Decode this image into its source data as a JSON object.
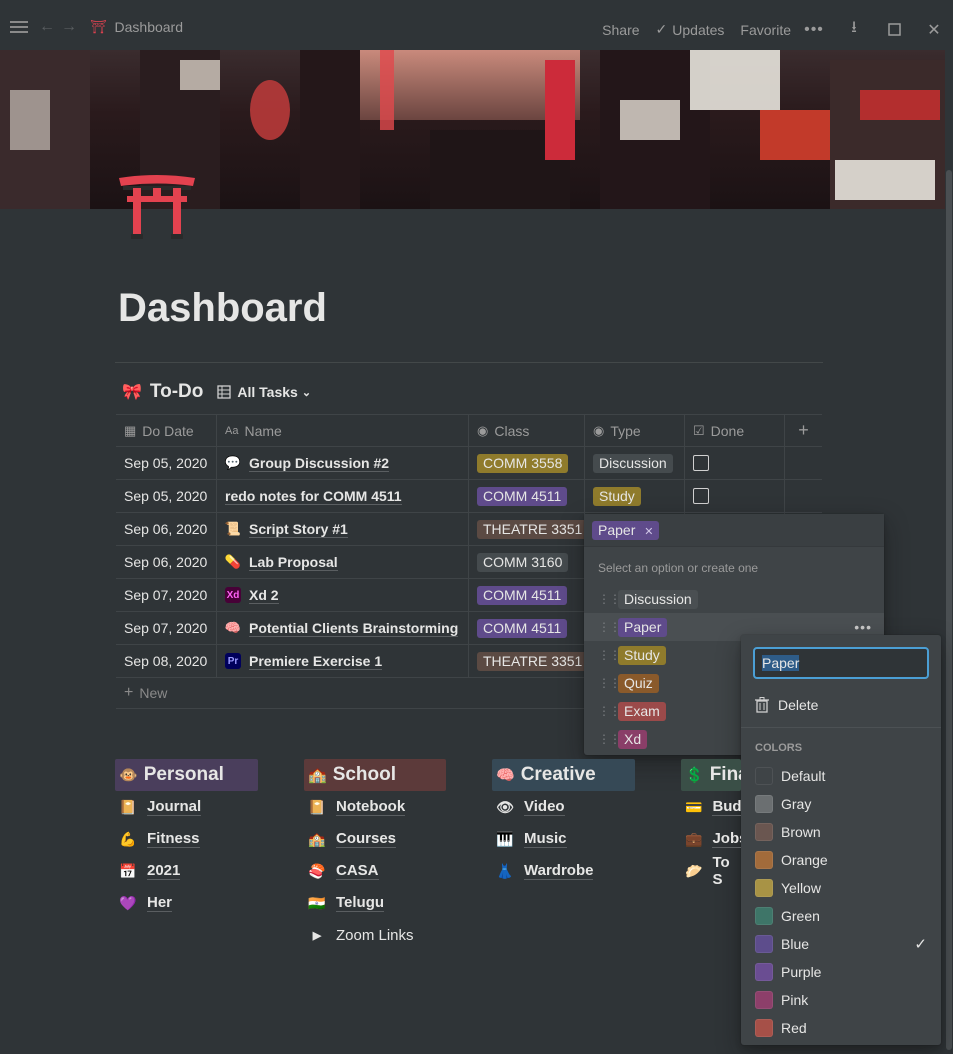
{
  "topbar": {
    "breadcrumb": "Dashboard",
    "share": "Share",
    "updates": "Updates",
    "favorite": "Favorite"
  },
  "page": {
    "title": "Dashboard"
  },
  "database": {
    "title": "To-Do",
    "view": "All Tasks",
    "columns": {
      "date": "Do Date",
      "name": "Name",
      "class": "Class",
      "type": "Type",
      "done": "Done"
    },
    "rows": [
      {
        "date": "Sep 05, 2020",
        "name": "Group Discussion #2",
        "icon": "speech-bubble-icon",
        "class": "COMM 3558",
        "class_color": "yellow",
        "type": "Discussion",
        "type_color": "gray"
      },
      {
        "date": "Sep 05, 2020",
        "name": "redo notes for COMM 4511",
        "icon": "",
        "class": "COMM 4511",
        "class_color": "purple",
        "type": "Study",
        "type_color": "yellow"
      },
      {
        "date": "Sep 06, 2020",
        "name": "Script Story #1",
        "icon": "scroll-icon",
        "class": "THEATRE 3351",
        "class_color": "brown",
        "type": "",
        "type_color": ""
      },
      {
        "date": "Sep 06, 2020",
        "name": "Lab Proposal",
        "icon": "pill-icon",
        "class": "COMM 3160",
        "class_color": "gray",
        "type": "",
        "type_color": ""
      },
      {
        "date": "Sep 07, 2020",
        "name": "Xd 2",
        "icon": "xd-icon",
        "class": "COMM 4511",
        "class_color": "purple",
        "type": "",
        "type_color": ""
      },
      {
        "date": "Sep 07, 2020",
        "name": "Potential Clients Brainstorming",
        "icon": "brain-icon",
        "class": "COMM 4511",
        "class_color": "purple",
        "type": "",
        "type_color": ""
      },
      {
        "date": "Sep 08, 2020",
        "name": "Premiere Exercise 1",
        "icon": "premiere-icon",
        "class": "THEATRE 3351",
        "class_color": "brown",
        "type": "",
        "type_color": ""
      }
    ],
    "new_label": "New"
  },
  "select_popup": {
    "selected_tag": "Paper",
    "hint": "Select an option or create one",
    "options": [
      {
        "label": "Discussion",
        "color": "#4a4f52"
      },
      {
        "label": "Paper",
        "color": "#5f4b8b"
      },
      {
        "label": "Study",
        "color": "#8f7b2c"
      },
      {
        "label": "Quiz",
        "color": "#8a5a2b"
      },
      {
        "label": "Exam",
        "color": "#9b4a4a"
      },
      {
        "label": "Xd",
        "color": "#8a3e68"
      }
    ]
  },
  "color_menu": {
    "input_value": "Paper",
    "delete_label": "Delete",
    "colors_heading": "COLORS",
    "colors": [
      {
        "label": "Default",
        "swatch": "#3f4447"
      },
      {
        "label": "Gray",
        "swatch": "#6b6f71"
      },
      {
        "label": "Brown",
        "swatch": "#6a5650"
      },
      {
        "label": "Orange",
        "swatch": "#a26b3b"
      },
      {
        "label": "Yellow",
        "swatch": "#a89345"
      },
      {
        "label": "Green",
        "swatch": "#3e7568"
      },
      {
        "label": "Blue",
        "swatch": "#5d4d8c"
      },
      {
        "label": "Purple",
        "swatch": "#6a4d92"
      },
      {
        "label": "Pink",
        "swatch": "#8d3f6a"
      },
      {
        "label": "Red",
        "swatch": "#a65048"
      }
    ],
    "selected": "Blue"
  },
  "nav_columns": [
    {
      "heading": "Personal",
      "heading_bg": "#4a3e5c",
      "icon": "monkey-icon",
      "items": [
        {
          "label": "Journal",
          "icon": "notebook-icon"
        },
        {
          "label": "Fitness",
          "icon": "flexed-arm-icon"
        },
        {
          "label": "2021",
          "icon": "calendar-icon"
        },
        {
          "label": "Her",
          "icon": "purple-heart-icon"
        }
      ]
    },
    {
      "heading": "School",
      "heading_bg": "#5c3a3a",
      "icon": "school-icon",
      "items": [
        {
          "label": "Notebook",
          "icon": "notebook-icon"
        },
        {
          "label": "Courses",
          "icon": "school-icon"
        },
        {
          "label": "CASA",
          "icon": "sushi-icon"
        },
        {
          "label": "Telugu",
          "icon": "india-flag-icon"
        },
        {
          "label": "Zoom Links",
          "icon": "toggle-triangle-icon"
        }
      ]
    },
    {
      "heading": "Creative",
      "heading_bg": "#364956",
      "icon": "brain-icon",
      "items": [
        {
          "label": "Video",
          "icon": "eye-icon"
        },
        {
          "label": "Music",
          "icon": "piano-icon"
        },
        {
          "label": "Wardrobe",
          "icon": "dress-icon"
        }
      ]
    },
    {
      "heading": "Fina",
      "heading_bg": "#3a4f47",
      "icon": "dollar-icon",
      "items": [
        {
          "label": "Budg",
          "icon": "credit-card-icon"
        },
        {
          "label": "Jobs",
          "icon": "briefcase-icon"
        },
        {
          "label": "To S",
          "icon": "dumpling-icon"
        }
      ]
    }
  ]
}
